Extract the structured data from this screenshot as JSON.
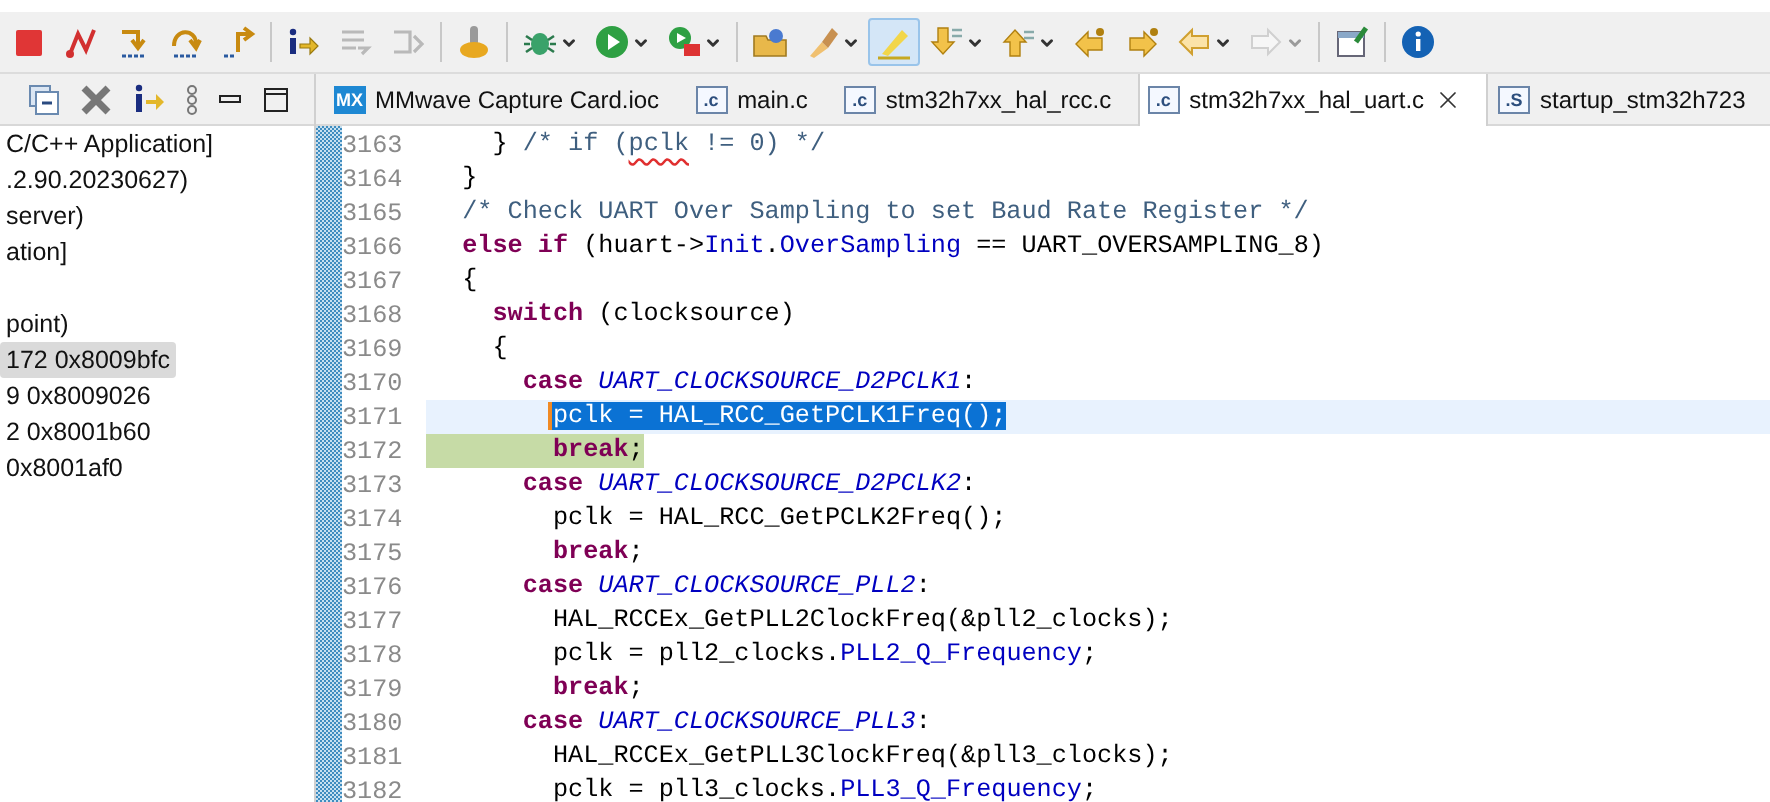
{
  "toolbar": [
    {
      "kind": "terminate",
      "disabled": false,
      "pressed": false,
      "dropdown": false
    },
    {
      "kind": "disconnect",
      "disabled": false,
      "pressed": false,
      "dropdown": false
    },
    {
      "kind": "step-into",
      "disabled": false,
      "pressed": false,
      "dropdown": false
    },
    {
      "kind": "step-over",
      "disabled": false,
      "pressed": false,
      "dropdown": false
    },
    {
      "kind": "step-return",
      "disabled": false,
      "pressed": false,
      "dropdown": false
    },
    {
      "kind": "separator"
    },
    {
      "kind": "instruction-step",
      "disabled": false,
      "pressed": false,
      "dropdown": false
    },
    {
      "kind": "step-filters",
      "disabled": true,
      "pressed": false,
      "dropdown": false
    },
    {
      "kind": "drop-frame",
      "disabled": true,
      "pressed": false,
      "dropdown": false
    },
    {
      "kind": "separator"
    },
    {
      "kind": "lever",
      "disabled": false,
      "pressed": false,
      "dropdown": false
    },
    {
      "kind": "separator"
    },
    {
      "kind": "debug",
      "disabled": false,
      "pressed": false,
      "dropdown": true
    },
    {
      "kind": "run",
      "disabled": false,
      "pressed": false,
      "dropdown": true
    },
    {
      "kind": "external",
      "disabled": false,
      "pressed": false,
      "dropdown": true
    },
    {
      "kind": "separator"
    },
    {
      "kind": "open",
      "disabled": false,
      "pressed": false,
      "dropdown": false
    },
    {
      "kind": "brush",
      "disabled": false,
      "pressed": false,
      "dropdown": true
    },
    {
      "kind": "highlight",
      "disabled": false,
      "pressed": true,
      "dropdown": false
    },
    {
      "kind": "next-annotation",
      "disabled": false,
      "pressed": false,
      "dropdown": true
    },
    {
      "kind": "prev-annotation",
      "disabled": false,
      "pressed": false,
      "dropdown": true
    },
    {
      "kind": "last-edit",
      "disabled": false,
      "pressed": false,
      "dropdown": false
    },
    {
      "kind": "next-edit",
      "disabled": false,
      "pressed": false,
      "dropdown": false
    },
    {
      "kind": "back",
      "disabled": false,
      "pressed": false,
      "dropdown": true
    },
    {
      "kind": "forward",
      "disabled": true,
      "pressed": false,
      "dropdown": true
    },
    {
      "kind": "separator"
    },
    {
      "kind": "pin-window",
      "disabled": false,
      "pressed": false,
      "dropdown": false
    },
    {
      "kind": "separator"
    },
    {
      "kind": "info",
      "disabled": false,
      "pressed": false,
      "dropdown": false
    }
  ],
  "debug_panel": {
    "items": [
      {
        "text": "C/C++ Application]",
        "selected": false
      },
      {
        "text": ".2.90.20230627)",
        "selected": false
      },
      {
        "text": "server)",
        "selected": false
      },
      {
        "text": "ation]",
        "selected": false
      },
      {
        "text": "point)",
        "selected": false
      },
      {
        "text": "172 0x8009bfc",
        "selected": true
      },
      {
        "text": "9 0x8009026",
        "selected": false
      },
      {
        "text": "2 0x8001b60",
        "selected": false
      },
      {
        "text": "0x8001af0",
        "selected": false
      }
    ]
  },
  "editor_tabs": [
    {
      "icon_text": "MX",
      "kind": "mx",
      "label": "MMwave Capture Card.ioc",
      "selected": false
    },
    {
      "icon_text": ".c",
      "kind": "c",
      "label": "main.c",
      "selected": false
    },
    {
      "icon_text": ".c",
      "kind": "c",
      "label": "stm32h7xx_hal_rcc.c",
      "selected": false
    },
    {
      "icon_text": ".c",
      "kind": "c",
      "label": "stm32h7xx_hal_uart.c",
      "selected": true
    },
    {
      "icon_text": ".S",
      "kind": "s",
      "label": "startup_stm32h723",
      "selected": false
    }
  ],
  "code_lines": [
    {
      "number": "3163",
      "selected": false,
      "current": false,
      "tokens": [
        {
          "kind": "plain",
          "text": "    } "
        },
        {
          "kind": "comment",
          "text": "/* if ("
        },
        {
          "kind": "misspelled",
          "text": "pclk"
        },
        {
          "kind": "comment",
          "text": " != 0) */"
        }
      ]
    },
    {
      "number": "3164",
      "selected": false,
      "current": false,
      "tokens": [
        {
          "kind": "plain",
          "text": "  }"
        }
      ]
    },
    {
      "number": "3165",
      "selected": false,
      "current": false,
      "tokens": [
        {
          "kind": "comment",
          "text": "  /* Check UART Over Sampling to set Baud Rate Register */"
        }
      ]
    },
    {
      "number": "3166",
      "selected": false,
      "current": false,
      "tokens": [
        {
          "kind": "keyword",
          "text": "  else if"
        },
        {
          "kind": "plain",
          "text": " (huart->"
        },
        {
          "kind": "field",
          "text": "Init"
        },
        {
          "kind": "plain",
          "text": "."
        },
        {
          "kind": "field",
          "text": "OverSampling"
        },
        {
          "kind": "plain",
          "text": " == UART_OVERSAMPLING_8)"
        }
      ]
    },
    {
      "number": "3167",
      "selected": false,
      "current": false,
      "tokens": [
        {
          "kind": "plain",
          "text": "  {"
        }
      ]
    },
    {
      "number": "3168",
      "selected": false,
      "current": false,
      "tokens": [
        {
          "kind": "keyword",
          "text": "    switch"
        },
        {
          "kind": "plain",
          "text": " (clocksource)"
        }
      ]
    },
    {
      "number": "3169",
      "selected": false,
      "current": false,
      "tokens": [
        {
          "kind": "plain",
          "text": "    {"
        }
      ]
    },
    {
      "number": "3170",
      "selected": false,
      "current": false,
      "tokens": [
        {
          "kind": "keyword",
          "text": "      case"
        },
        {
          "kind": "constant",
          "text": " UART_CLOCKSOURCE_D2PCLK1"
        },
        {
          "kind": "plain",
          "text": ":"
        }
      ]
    },
    {
      "number": "3171",
      "selected": true,
      "current": false,
      "tokens": [
        {
          "kind": "code",
          "text": "        pclk = HAL_RCC_GetPCLK1Freq();"
        }
      ]
    },
    {
      "number": "3172",
      "selected": false,
      "current": true,
      "tokens": [
        {
          "kind": "keyword",
          "text": "        break"
        },
        {
          "kind": "plain",
          "text": ";"
        }
      ]
    },
    {
      "number": "3173",
      "selected": false,
      "current": false,
      "tokens": [
        {
          "kind": "keyword",
          "text": "      case"
        },
        {
          "kind": "constant",
          "text": " UART_CLOCKSOURCE_D2PCLK2"
        },
        {
          "kind": "plain",
          "text": ":"
        }
      ]
    },
    {
      "number": "3174",
      "selected": false,
      "current": false,
      "tokens": [
        {
          "kind": "plain",
          "text": "        pclk = HAL_RCC_GetPCLK2Freq();"
        }
      ]
    },
    {
      "number": "3175",
      "selected": false,
      "current": false,
      "tokens": [
        {
          "kind": "keyword",
          "text": "        break"
        },
        {
          "kind": "plain",
          "text": ";"
        }
      ]
    },
    {
      "number": "3176",
      "selected": false,
      "current": false,
      "tokens": [
        {
          "kind": "keyword",
          "text": "      case"
        },
        {
          "kind": "constant",
          "text": " UART_CLOCKSOURCE_PLL2"
        },
        {
          "kind": "plain",
          "text": ":"
        }
      ]
    },
    {
      "number": "3177",
      "selected": false,
      "current": false,
      "tokens": [
        {
          "kind": "plain",
          "text": "        HAL_RCCEx_GetPLL2ClockFreq(&pll2_clocks);"
        }
      ]
    },
    {
      "number": "3178",
      "selected": false,
      "current": false,
      "tokens": [
        {
          "kind": "plain",
          "text": "        pclk = pll2_clocks."
        },
        {
          "kind": "field",
          "text": "PLL2_Q_Frequency"
        },
        {
          "kind": "plain",
          "text": ";"
        }
      ]
    },
    {
      "number": "3179",
      "selected": false,
      "current": false,
      "tokens": [
        {
          "kind": "keyword",
          "text": "        break"
        },
        {
          "kind": "plain",
          "text": ";"
        }
      ]
    },
    {
      "number": "3180",
      "selected": false,
      "current": false,
      "tokens": [
        {
          "kind": "keyword",
          "text": "      case"
        },
        {
          "kind": "constant",
          "text": " UART_CLOCKSOURCE_PLL3"
        },
        {
          "kind": "plain",
          "text": ":"
        }
      ]
    },
    {
      "number": "3181",
      "selected": false,
      "current": false,
      "tokens": [
        {
          "kind": "plain",
          "text": "        HAL_RCCEx_GetPLL3ClockFreq(&pll3_clocks);"
        }
      ]
    },
    {
      "number": "3182",
      "selected": false,
      "current": false,
      "tokens": [
        {
          "kind": "plain",
          "text": "        pclk = pll3_clocks."
        },
        {
          "kind": "field",
          "text": "PLL3_Q_Frequency"
        },
        {
          "kind": "plain",
          "text": ";"
        }
      ]
    }
  ]
}
